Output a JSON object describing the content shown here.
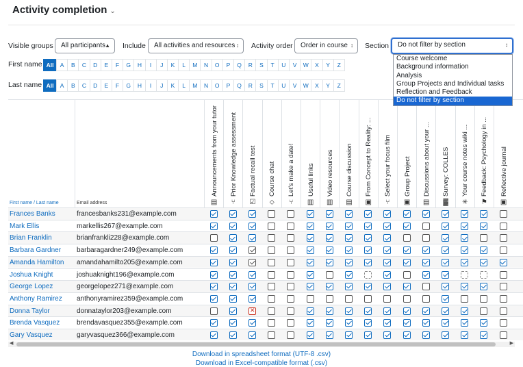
{
  "page": {
    "title": "Activity completion"
  },
  "filters": {
    "visible_groups_label": "Visible groups",
    "visible_groups_value": "All participants",
    "include_label": "Include",
    "include_value": "All activities and resources",
    "order_label": "Activity order",
    "order_value": "Order in course",
    "section_label": "Section",
    "section_value": "Do not filter by section",
    "section_options": [
      "Course welcome",
      "Background information",
      "Analysis",
      "Group Projects and Individual tasks",
      "Reflection and Feedback",
      "Do not filter by section"
    ]
  },
  "initials": {
    "first_label": "First name",
    "last_label": "Last name",
    "all": "All",
    "letters": [
      "A",
      "B",
      "C",
      "D",
      "E",
      "F",
      "G",
      "H",
      "I",
      "J",
      "K",
      "L",
      "M",
      "N",
      "O",
      "P",
      "Q",
      "R",
      "S",
      "T",
      "U",
      "V",
      "W",
      "X",
      "Y",
      "Z"
    ]
  },
  "table": {
    "name_header": "First name / Last name",
    "email_header": "Email address",
    "activities": [
      {
        "name": "Announcements from your tutor",
        "icon": "forum-icon",
        "glyph": "▤"
      },
      {
        "name": "Prior Knowledge assessment",
        "icon": "choice-icon",
        "glyph": "⑂"
      },
      {
        "name": "Factual recall test",
        "icon": "quiz-icon",
        "glyph": "☑"
      },
      {
        "name": "Course chat",
        "icon": "chat-icon",
        "glyph": "⬦"
      },
      {
        "name": "Let's make a date!",
        "icon": "choice-icon",
        "glyph": "⑂"
      },
      {
        "name": "Useful links",
        "icon": "book-icon",
        "glyph": "▥"
      },
      {
        "name": "Video resources",
        "icon": "book-icon",
        "glyph": "▥"
      },
      {
        "name": "Course discussion",
        "icon": "forum-icon",
        "glyph": "▤"
      },
      {
        "name": "From Concept to Reality: ...",
        "icon": "assign-icon",
        "glyph": "▣"
      },
      {
        "name": "Select your focus film",
        "icon": "choice-icon",
        "glyph": "⑂"
      },
      {
        "name": "Group Project",
        "icon": "assign-icon",
        "glyph": "▣"
      },
      {
        "name": "Discussions about your ...",
        "icon": "forum-icon",
        "glyph": "▤"
      },
      {
        "name": "Survey: COLLES",
        "icon": "survey-icon",
        "glyph": "▓"
      },
      {
        "name": "Your course notes wiki ...",
        "icon": "wiki-icon",
        "glyph": "✳"
      },
      {
        "name": "Feedback: Psychology in ...",
        "icon": "feedback-icon",
        "glyph": "⚑"
      },
      {
        "name": "Reflective journal",
        "icon": "assign-icon",
        "glyph": "▣"
      }
    ],
    "rows": [
      {
        "name": "Frances Banks",
        "email": "francesbanks231@example.com",
        "states": [
          "c",
          "c",
          "c",
          "e",
          "e",
          "c",
          "c",
          "c",
          "c",
          "c",
          "c",
          "c",
          "c",
          "c",
          "c",
          "e"
        ]
      },
      {
        "name": "Mark Ellis",
        "email": "markellis267@example.com",
        "states": [
          "c",
          "c",
          "c",
          "e",
          "e",
          "c",
          "c",
          "c",
          "c",
          "c",
          "c",
          "e",
          "c",
          "c",
          "c",
          "e"
        ]
      },
      {
        "name": "Brian Franklin",
        "email": "brianfrankli228@example.com",
        "states": [
          "e",
          "c",
          "c",
          "e",
          "e",
          "c",
          "c",
          "c",
          "c",
          "c",
          "e",
          "e",
          "c",
          "c",
          "e",
          "e"
        ]
      },
      {
        "name": "Barbara Gardner",
        "email": "barbaragardner249@example.com",
        "states": [
          "c",
          "c",
          "m",
          "e",
          "e",
          "c",
          "c",
          "c",
          "c",
          "c",
          "c",
          "c",
          "c",
          "c",
          "c",
          "e"
        ]
      },
      {
        "name": "Amanda Hamilton",
        "email": "amandahamilto205@example.com",
        "states": [
          "c",
          "c",
          "m",
          "e",
          "e",
          "c",
          "c",
          "c",
          "c",
          "c",
          "c",
          "c",
          "c",
          "c",
          "c",
          "c"
        ]
      },
      {
        "name": "Joshua Knight",
        "email": "joshuaknight196@example.com",
        "states": [
          "c",
          "c",
          "c",
          "e",
          "e",
          "c",
          "e",
          "c",
          "d",
          "c",
          "e",
          "c",
          "c",
          "d",
          "d",
          "e"
        ]
      },
      {
        "name": "George Lopez",
        "email": "georgelopez271@example.com",
        "states": [
          "c",
          "c",
          "c",
          "e",
          "e",
          "c",
          "c",
          "c",
          "c",
          "c",
          "c",
          "e",
          "c",
          "c",
          "c",
          "e"
        ]
      },
      {
        "name": "Anthony Ramirez",
        "email": "anthonyramirez359@example.com",
        "states": [
          "c",
          "c",
          "c",
          "e",
          "e",
          "e",
          "e",
          "e",
          "e",
          "e",
          "e",
          "e",
          "c",
          "e",
          "e",
          "e"
        ]
      },
      {
        "name": "Donna Taylor",
        "email": "donnataylor203@example.com",
        "states": [
          "e",
          "c",
          "x",
          "e",
          "e",
          "c",
          "c",
          "c",
          "c",
          "c",
          "c",
          "c",
          "c",
          "c",
          "e",
          "e"
        ]
      },
      {
        "name": "Brenda Vasquez",
        "email": "brendavasquez355@example.com",
        "states": [
          "c",
          "c",
          "c",
          "e",
          "e",
          "c",
          "c",
          "c",
          "c",
          "c",
          "c",
          "c",
          "c",
          "c",
          "c",
          "e"
        ]
      },
      {
        "name": "Gary Vasquez",
        "email": "garyvasquez366@example.com",
        "states": [
          "c",
          "c",
          "c",
          "e",
          "e",
          "c",
          "c",
          "c",
          "c",
          "c",
          "c",
          "c",
          "c",
          "c",
          "c",
          "e"
        ]
      }
    ]
  },
  "downloads": {
    "csv": "Download in spreadsheet format (UTF-8 .csv)",
    "excel": "Download in Excel-compatible format (.csv)"
  }
}
